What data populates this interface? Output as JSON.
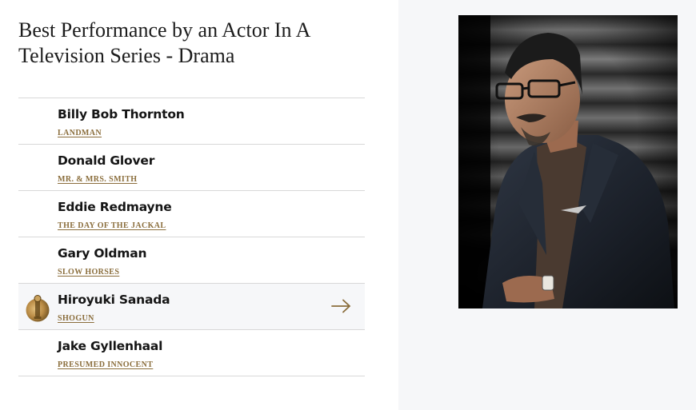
{
  "category": {
    "title": "Best Performance by an Actor In A Television Series - Drama"
  },
  "nominees": [
    {
      "name": "Billy Bob Thornton",
      "show": "LANDMAN",
      "winner": false
    },
    {
      "name": "Donald Glover",
      "show": "MR. & MRS. SMITH",
      "winner": false
    },
    {
      "name": "Eddie Redmayne",
      "show": "THE DAY OF THE JACKAL",
      "winner": false
    },
    {
      "name": "Gary Oldman",
      "show": "SLOW HORSES",
      "winner": false
    },
    {
      "name": "Hiroyuki Sanada",
      "show": "SHOGUN",
      "winner": true
    },
    {
      "name": "Jake Gyllenhaal",
      "show": "PRESUMED INNOCENT",
      "winner": false
    }
  ],
  "icons": {
    "winner_badge": "golden-globe-trophy-icon",
    "row_arrow": "arrow-right-icon"
  },
  "colors": {
    "accent_gold": "#8a6d3b",
    "winner_row_bg": "#f6f7f9",
    "photo_panel_bg": "#f6f7f9",
    "divider": "#d8d8d8"
  }
}
